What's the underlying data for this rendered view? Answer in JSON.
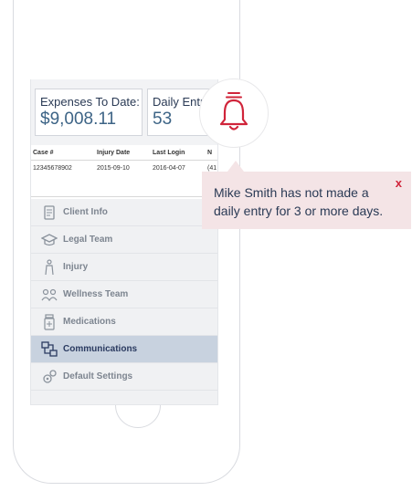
{
  "cards": {
    "expenses": {
      "label": "Expenses To Date:",
      "value": "$9,008.11"
    },
    "daily": {
      "label": "Daily Entri",
      "value": "53"
    }
  },
  "table": {
    "headers": [
      "Case #",
      "Injury Date",
      "Last Login",
      "N"
    ],
    "row": [
      "12345678902",
      "2015-09-10",
      "2016-04-07",
      "(41"
    ]
  },
  "menu": {
    "items": [
      {
        "label": "Client Info",
        "icon": "client-info-icon"
      },
      {
        "label": "Legal Team",
        "icon": "legal-team-icon"
      },
      {
        "label": "Injury",
        "icon": "injury-icon"
      },
      {
        "label": "Wellness Team",
        "icon": "wellness-team-icon"
      },
      {
        "label": "Medications",
        "icon": "medications-icon"
      },
      {
        "label": "Communications",
        "icon": "communications-icon",
        "active": true
      },
      {
        "label": "Default Settings",
        "icon": "settings-icon"
      }
    ]
  },
  "notification": {
    "message": "Mike Smith has not made a daily entry for 3 or more days.",
    "close_label": "x",
    "icon": "bell-icon"
  },
  "colors": {
    "accent": "#d0243a",
    "navy": "#2a3a55",
    "value_blue": "#3d6486",
    "active_menu": "#c8d2df",
    "popup_bg": "#f4e4e6"
  }
}
